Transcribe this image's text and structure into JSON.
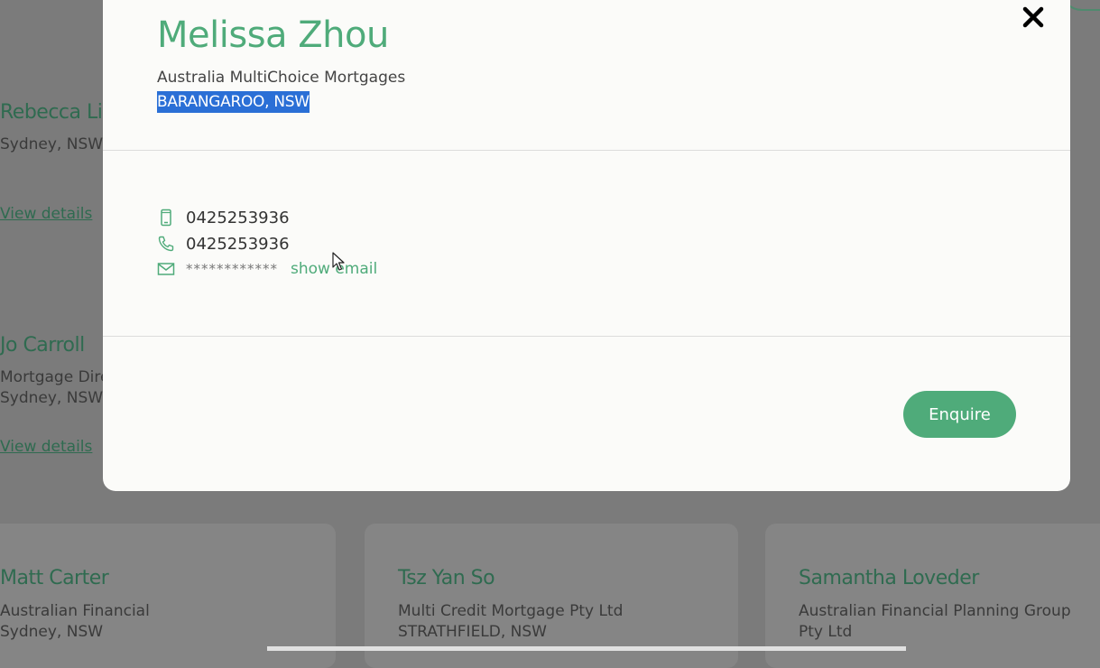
{
  "background": {
    "cards": [
      {
        "name": "Rebecca Li",
        "lines": [
          "Sydney, NSW"
        ],
        "link": "View details"
      },
      {
        "name": "Jo Carroll",
        "lines": [
          "Mortgage Dire",
          "Sydney, NSW"
        ],
        "link": "View details"
      },
      {
        "name": "Matt Carter",
        "lines": [
          "Australian Financial",
          "Sydney, NSW"
        ]
      },
      {
        "name": "Tsz Yan So",
        "lines": [
          "Multi Credit Mortgage Pty Ltd",
          "STRATHFIELD, NSW"
        ]
      },
      {
        "name": "Samantha Loveder",
        "lines": [
          "Australian Financial Planning Group",
          "Pty Ltd"
        ]
      }
    ]
  },
  "modal": {
    "name": "Melissa Zhou",
    "company": "Australia MultiChoice Mortgages",
    "location": "BARANGAROO, NSW",
    "mobile": "0425253936",
    "phone": "0425253936",
    "email_masked": "************",
    "show_email_label": "show email",
    "enquire_label": "Enquire"
  },
  "colors": {
    "accent": "#4fab7a",
    "selection": "#2a6fd6"
  }
}
